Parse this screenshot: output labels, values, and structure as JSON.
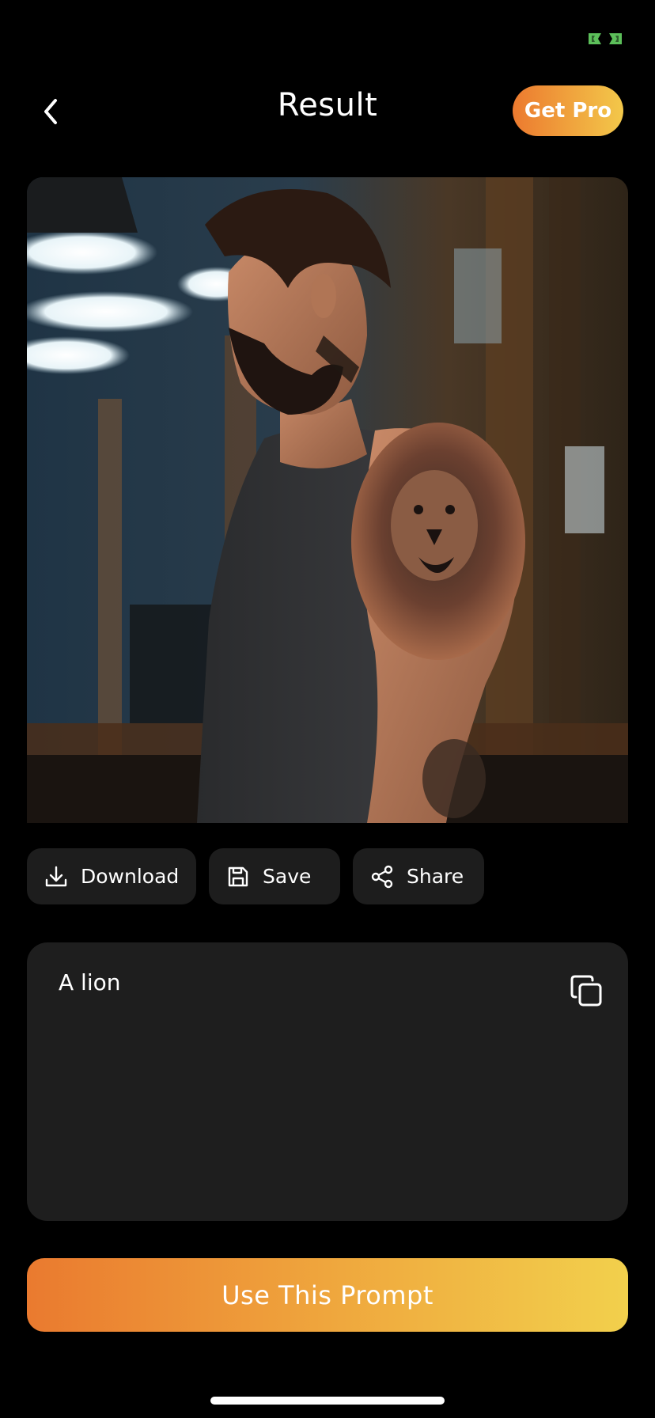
{
  "status": {
    "indicator_color": "#5cbf5a"
  },
  "header": {
    "back_icon": "chevron-left-icon",
    "title": "Result",
    "get_pro_label": "Get Pro",
    "accent_gradient": [
      "#ec7a2f",
      "#f3c84a"
    ]
  },
  "result": {
    "image_description": "man-with-lion-shoulder-tattoo"
  },
  "actions": {
    "download_label": "Download",
    "download_icon": "download-icon",
    "save_label": "Save",
    "save_icon": "floppy-disk-icon",
    "share_label": "Share",
    "share_icon": "share-icon"
  },
  "prompt": {
    "text": "A lion",
    "copy_icon": "copy-icon"
  },
  "cta": {
    "use_prompt_label": "Use This Prompt"
  }
}
